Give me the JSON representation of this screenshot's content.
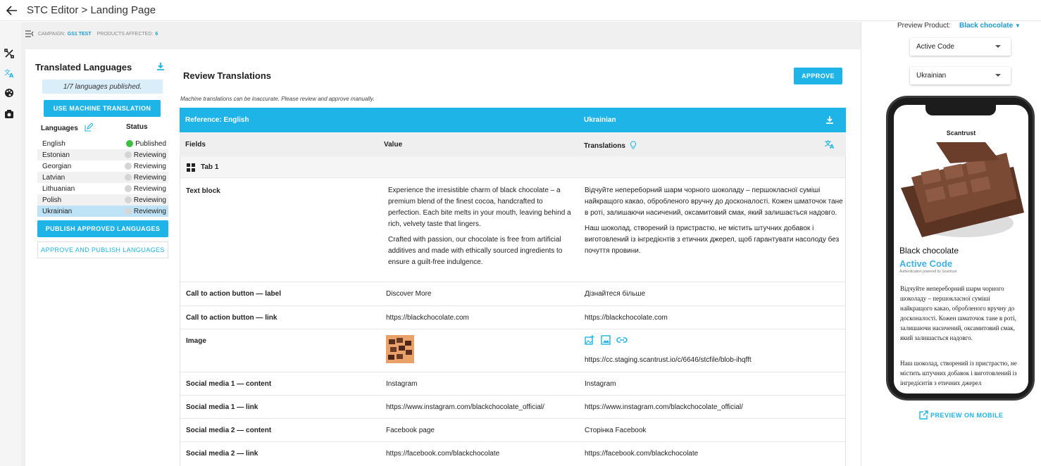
{
  "header": {
    "title": "STC Editor > Landing Page"
  },
  "subbar": {
    "campaign_label": "CAMPAIGN:",
    "campaign_value": "GS1 TEST",
    "products_label": "PRODUCTS AFFECTED:",
    "products_value": "6"
  },
  "lang_panel": {
    "title": "Translated Languages",
    "published_note": "1/7 languages published.",
    "machine_btn": "USE MACHINE TRANSLATION",
    "col_languages": "Languages",
    "col_status": "Status",
    "languages": [
      {
        "name": "English",
        "status": "Published"
      },
      {
        "name": "Estonian",
        "status": "Reviewing"
      },
      {
        "name": "Georgian",
        "status": "Reviewing"
      },
      {
        "name": "Latvian",
        "status": "Reviewing"
      },
      {
        "name": "Lithuanian",
        "status": "Reviewing"
      },
      {
        "name": "Polish",
        "status": "Reviewing"
      },
      {
        "name": "Ukrainian",
        "status": "Reviewing"
      }
    ],
    "publish_btn": "PUBLISH APPROVED LANGUAGES",
    "approve_publish_btn": "APPROVE AND PUBLISH LANGUAGES"
  },
  "review": {
    "title": "Review Translations",
    "approve_btn": "APPROVE",
    "note": "Machine translations can be inaccurate. Please review and approve manually.",
    "reference_label": "Reference: English",
    "target_label": "Ukrainian",
    "col_fields": "Fields",
    "col_value": "Value",
    "col_translations": "Translations",
    "tab_label": "Tab 1",
    "rows": {
      "text_block": {
        "field": "Text block",
        "value_p1": "Experience the irresistible charm of black chocolate – a premium blend of the finest cocoa, handcrafted to perfection. Each bite melts in your mouth, leaving behind a rich, velvety taste that lingers.",
        "value_p2": "Crafted with passion, our chocolate is free from artificial additives and made with ethically sourced ingredients to ensure a guilt-free indulgence.",
        "trans_p1": "Відчуйте непереборний шарм чорного шоколаду – першокласної суміші найкращого какао, обробленого вручну до досконалості. Кожен шматочок тане в роті, залишаючи насичений, оксамитовий смак, який залишається надовго.",
        "trans_p2": "Наш шоколад, створений із пристрастю, не містить штучних добавок і виготовлений із інгредієнтів з етичних джерел, щоб гарантувати насолоду без почуття провини."
      },
      "cta_label": {
        "field": "Call to action button — label",
        "value": "Discover More",
        "trans": "Дізнайтеся більше"
      },
      "cta_link": {
        "field": "Call to action button — link",
        "value": "https://blackchocolate.com",
        "trans": "https://blackchocolate.com"
      },
      "image": {
        "field": "Image",
        "trans": "https://cc.staging.scantrust.io/c/6646/stcfile/blob-ihqfft"
      },
      "sm1_content": {
        "field": "Social media 1 — content",
        "value": "Instagram",
        "trans": "Instagram"
      },
      "sm1_link": {
        "field": "Social media 1 — link",
        "value": "https://www.instagram.com/blackchocolate_official/",
        "trans": "https://www.instagram.com/blackchocolate_official/"
      },
      "sm2_content": {
        "field": "Social media 2 — content",
        "value": "Facebook page",
        "trans": "Сторінка Facebook"
      },
      "sm2_link": {
        "field": "Social media 2 — link",
        "value": "https://facebook.com/blackchocolate",
        "trans": "https://facebook.com/blackchocolate"
      }
    }
  },
  "preview": {
    "product_label": "Preview Product:",
    "product_value": "Black chocolate",
    "select_code": "Active Code",
    "select_lang": "Ukrainian",
    "screen": {
      "brand": "Scantrust",
      "product": "Black chocolate",
      "code": "Active Code",
      "auth": "Authentication powered by Scantrust",
      "p1": "Відчуйте непереборний шарм чорного шоколаду – першокласної суміші найкращого какао, обробленого вручну до досконалості. Кожен шматочок тане в роті, залишаючи насичений, оксамитовий смак, який залишається надовго.",
      "p2": "Наш шоколад, створений із пристрастю, не містить штучних добавок і виготовлений із інгредієнтів з етичних джерел"
    },
    "mobile_btn": "PREVIEW ON MOBILE"
  },
  "colors": {
    "accent": "#1eb4e8",
    "published": "#3fbf3f",
    "reviewing": "#d5d5d5",
    "selected_row": "#bfe3f6"
  }
}
